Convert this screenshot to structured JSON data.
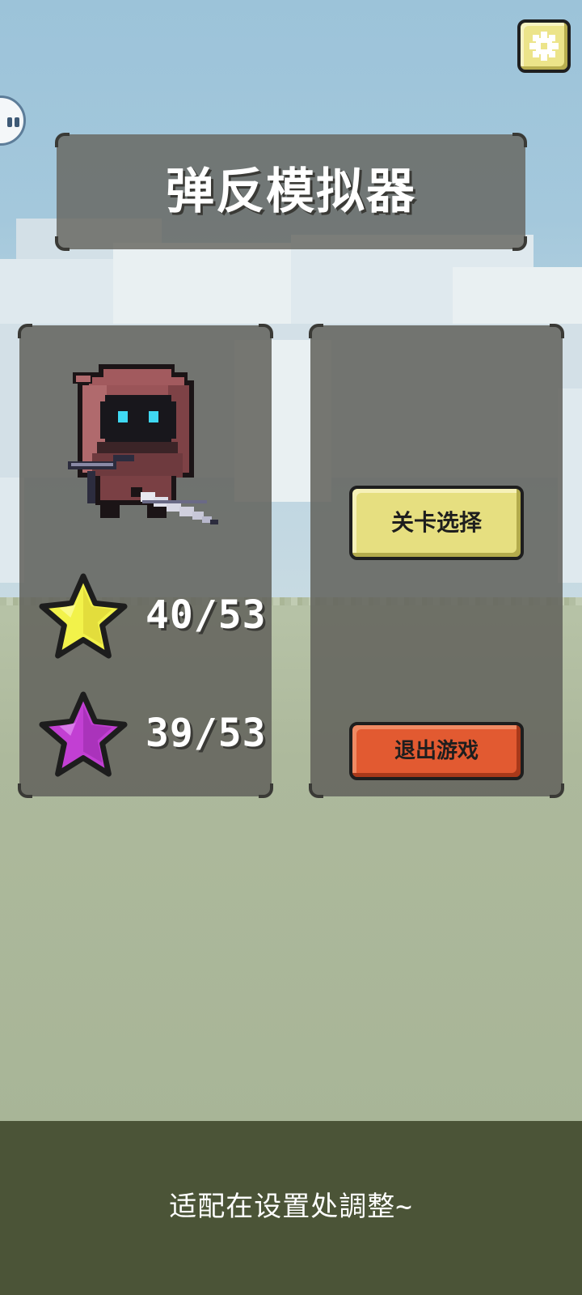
{
  "title": "弹反模拟器",
  "stats": {
    "gold_stars": "40/53",
    "purple_stars": "39/53"
  },
  "buttons": {
    "level_select": "关卡选择",
    "exit_game": "退出游戏"
  },
  "footer": {
    "hint": "适配在设置处調整~"
  },
  "icons": {
    "settings": "gear-icon",
    "floating": "floating-assistant-icon",
    "gold_star": "gold-star-icon",
    "purple_star": "purple-star-icon",
    "character": "hooded-swordsman-character"
  },
  "colors": {
    "sky": "#9cc3d9",
    "ground": "#a9b698",
    "panel": "#62625c",
    "level_button": "#e6df80",
    "exit_button": "#e25a31",
    "settings_button": "#ece48a",
    "gold_star": "#f2f24a",
    "purple_star": "#c23fd3",
    "footer_bar": "#4b5437"
  }
}
